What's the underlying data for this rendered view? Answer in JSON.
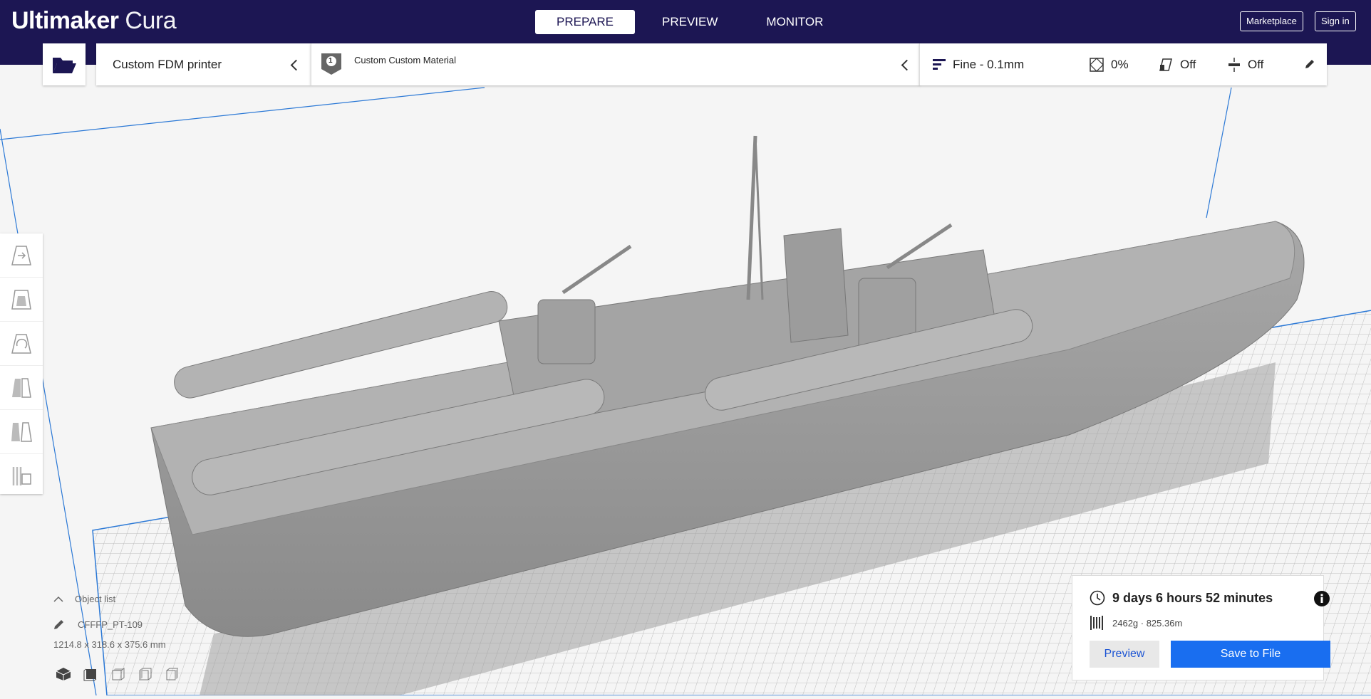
{
  "app": {
    "logo_bold": "Ultimaker",
    "logo_light": "Cura"
  },
  "stages": [
    {
      "label": "PREPARE",
      "active": true
    },
    {
      "label": "PREVIEW",
      "active": false
    },
    {
      "label": "MONITOR",
      "active": false
    }
  ],
  "header": {
    "marketplace_label": "Marketplace",
    "signin_label": "Sign in"
  },
  "printer": {
    "name": "Custom FDM printer"
  },
  "material": {
    "extruder_number": "1",
    "name": "Custom Custom Material"
  },
  "print_settings": {
    "profile": "Fine - 0.1mm",
    "infill": "0%",
    "support": "Off",
    "adhesion": "Off"
  },
  "object_list": {
    "header": "Object list",
    "object_name": "CFFFP_PT-109",
    "dimensions": "1214.8 x 318.6 x 375.6 mm"
  },
  "print_info": {
    "time": "9 days 6 hours 52 minutes",
    "material_usage": "2462g · 825.36m",
    "preview_label": "Preview",
    "save_label": "Save to File"
  },
  "colors": {
    "header_bg": "#1c1653",
    "accent_blue": "#196ef0",
    "model_gray": "#9a9a9a",
    "build_volume_line": "#2c79d6"
  },
  "icons": {
    "open": "folder-open-icon",
    "profile": "layers-icon",
    "infill": "infill-icon",
    "support": "support-icon",
    "adhesion": "adhesion-icon",
    "edit": "pencil-icon",
    "time": "clock-icon",
    "material": "spool-icon",
    "info": "info-icon"
  }
}
